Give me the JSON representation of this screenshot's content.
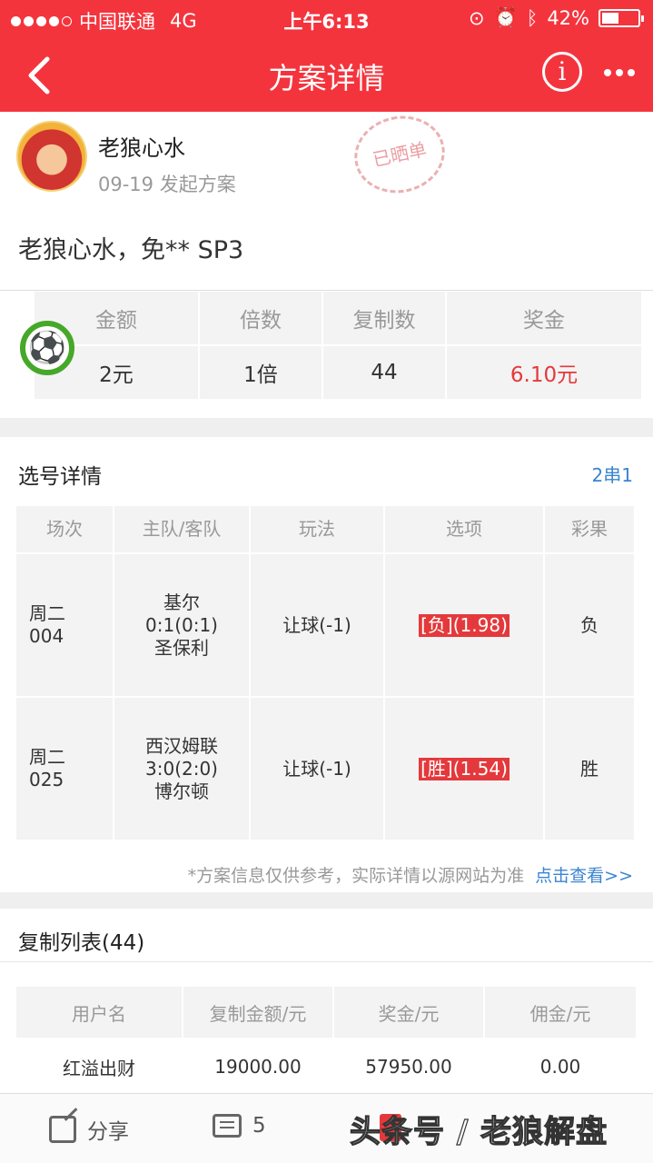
{
  "status_bar": {
    "carrier": "中国联通",
    "network": "4G",
    "time": "上午6:13",
    "battery": "42%",
    "battery_level": 0.42
  },
  "nav": {
    "title": "方案详情",
    "back_icon": "chevron-left-icon",
    "info_glyph": "i",
    "more_icon": "more-icon"
  },
  "plan": {
    "author": "老狼心水",
    "date": "09-19 发起方案",
    "stamp": "已晒单",
    "description": "老狼心水，免** SP3",
    "stats_headers": [
      "金额",
      "倍数",
      "复制数",
      "奖金"
    ],
    "stats_values": [
      "2元",
      "1倍",
      "44",
      "6.10元"
    ]
  },
  "selection": {
    "title": "选号详情",
    "combo": "2串1",
    "headers": [
      "场次",
      "主队/客队",
      "玩法",
      "选项",
      "彩果"
    ],
    "rows": [
      {
        "match_day": "周二",
        "match_no": "004",
        "home": "基尔",
        "score": "0:1(0:1)",
        "away": "圣保利",
        "play": "让球(-1)",
        "option_pick": "[负]",
        "option_odds": "(1.98)",
        "result": "负"
      },
      {
        "match_day": "周二",
        "match_no": "025",
        "home": "西汉姆联",
        "score": "3:0(2:0)",
        "away": "博尔顿",
        "play": "让球(-1)",
        "option_pick": "[胜]",
        "option_odds": "(1.54)",
        "result": "胜"
      }
    ],
    "note": "*方案信息仅供参考，实际详情以源网站为准",
    "view_link": "点击查看>>"
  },
  "copy_list": {
    "title": "复制列表(44)",
    "headers": [
      "用户名",
      "复制金额/元",
      "奖金/元",
      "佣金/元"
    ],
    "rows": [
      {
        "user": "红溢出财",
        "amount": "19000.00",
        "prize": "57950.00",
        "commission": "0.00"
      }
    ]
  },
  "bottom_bar": {
    "share_label": "分享",
    "comment_count": "5",
    "watermark": "头条号 / 老狼解盘"
  },
  "colors": {
    "brand_red": "#f4343d",
    "accent_red": "#e4393c",
    "link_blue": "#3b84d0"
  }
}
